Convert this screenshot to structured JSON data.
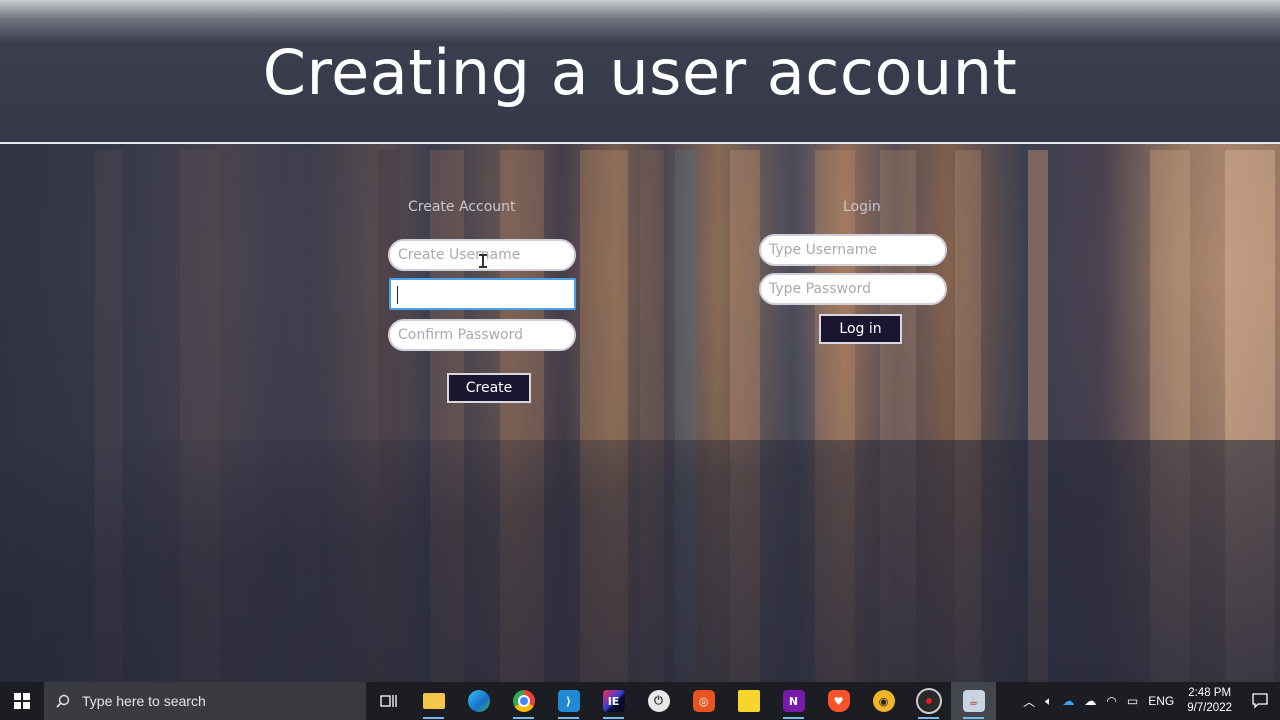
{
  "title": "Creating a user account",
  "create_account": {
    "heading": "Create Account",
    "username_placeholder": "Create Username",
    "password_value": "",
    "confirm_placeholder": "Confirm Password",
    "create_button": "Create"
  },
  "login": {
    "heading": "Login",
    "username_placeholder": "Type Username",
    "password_placeholder": "Type Password",
    "login_button": "Log in"
  },
  "taskbar": {
    "search_placeholder": "Type here to search",
    "pinned_icons": [
      "task-view-icon",
      "file-explorer-icon",
      "edge-icon",
      "chrome-icon",
      "vscode-icon",
      "intellij-icon",
      "power-icon",
      "ubuntu-icon",
      "sticky-notes-icon",
      "onenote-icon",
      "brave-icon",
      "gold-browser-icon",
      "screen-recorder-icon",
      "java-app-icon"
    ],
    "language": "ENG",
    "time": "2:48 PM",
    "date": "9/7/2022"
  },
  "colors": {
    "button_bg": "#1c1530",
    "focus_border": "#4aa3e8",
    "taskbar_bg": "#1c1d22"
  }
}
